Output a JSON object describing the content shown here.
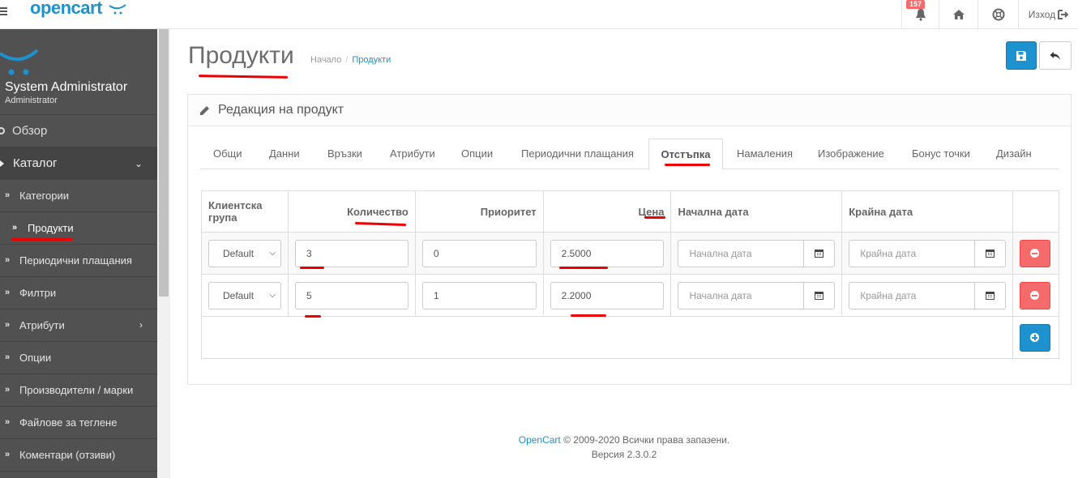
{
  "header": {
    "logo": "opencart",
    "notifications_count": "157",
    "logout_label": "Изход"
  },
  "sidebar": {
    "user_name": "System Administrator",
    "user_role": "Administrator",
    "items": [
      {
        "label": "Обзор"
      },
      {
        "label": "Каталог"
      }
    ],
    "sub_items": [
      {
        "label": "Категории"
      },
      {
        "label": "Продукти"
      },
      {
        "label": "Периодични плащания"
      },
      {
        "label": "Филтри"
      },
      {
        "label": "Атрибути"
      },
      {
        "label": "Опции"
      },
      {
        "label": "Производители / марки"
      },
      {
        "label": "Файлове за теглене"
      },
      {
        "label": "Коментари (отзиви)"
      }
    ]
  },
  "page": {
    "title": "Продукти",
    "breadcrumb": [
      "Начало",
      "Продукти"
    ]
  },
  "panel": {
    "heading": "Редакция на продукт"
  },
  "tabs": [
    "Общи",
    "Данни",
    "Връзки",
    "Атрибути",
    "Опции",
    "Периодични плащания",
    "Отстъпка",
    "Намаления",
    "Изображение",
    "Бонус точки",
    "Дизайн"
  ],
  "active_tab": "Отстъпка",
  "table": {
    "headers": {
      "customer_group": "Клиентска група",
      "quantity": "Количество",
      "priority": "Приоритет",
      "price": "Цена",
      "date_start": "Начална дата",
      "date_end": "Крайна дата"
    },
    "rows": [
      {
        "customer_group": "Default",
        "quantity": "3",
        "priority": "0",
        "price": "2.5000",
        "date_start_placeholder": "Начална дата",
        "date_end_placeholder": "Крайна дата"
      },
      {
        "customer_group": "Default",
        "quantity": "5",
        "priority": "1",
        "price": "2.2000",
        "date_start_placeholder": "Начална дата",
        "date_end_placeholder": "Крайна дата"
      }
    ]
  },
  "footer": {
    "brand": "OpenCart",
    "copyright": "© 2009-2020 Всички права запазени.",
    "version": "Версия 2.3.0.2"
  },
  "colors": {
    "primary": "#1e91cf",
    "danger": "#f56b6b",
    "sidebar": "#515151",
    "annotation": "#e00000"
  }
}
